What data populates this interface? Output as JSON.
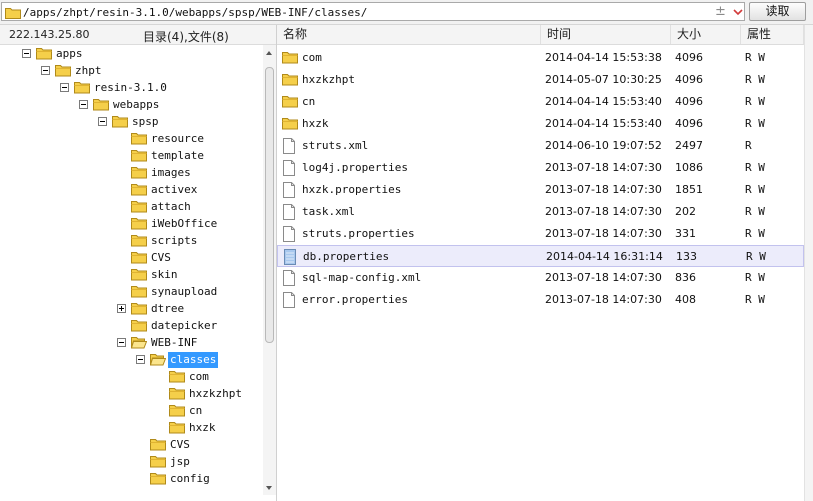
{
  "address": {
    "path": "/apps/zhpt/resin-3.1.0/webapps/spsp/WEB-INF/classes/",
    "pin_glyph": "±",
    "read_label": "读取"
  },
  "left": {
    "ip": "222.143.25.80",
    "summary": "目录(4),文件(8)",
    "tree": [
      {
        "label": "apps",
        "level": 0,
        "toggle": "minus"
      },
      {
        "label": "zhpt",
        "level": 1,
        "toggle": "minus"
      },
      {
        "label": "resin-3.1.0",
        "level": 2,
        "toggle": "minus"
      },
      {
        "label": "webapps",
        "level": 3,
        "toggle": "minus"
      },
      {
        "label": "spsp",
        "level": 4,
        "toggle": "minus"
      },
      {
        "label": "resource",
        "level": 5,
        "toggle": "none"
      },
      {
        "label": "template",
        "level": 5,
        "toggle": "none"
      },
      {
        "label": "images",
        "level": 5,
        "toggle": "none"
      },
      {
        "label": "activex",
        "level": 5,
        "toggle": "none"
      },
      {
        "label": "attach",
        "level": 5,
        "toggle": "none"
      },
      {
        "label": "iWebOffice",
        "level": 5,
        "toggle": "none"
      },
      {
        "label": "scripts",
        "level": 5,
        "toggle": "none"
      },
      {
        "label": "CVS",
        "level": 5,
        "toggle": "none"
      },
      {
        "label": "skin",
        "level": 5,
        "toggle": "none"
      },
      {
        "label": "synaupload",
        "level": 5,
        "toggle": "none"
      },
      {
        "label": "dtree",
        "level": 5,
        "toggle": "plus"
      },
      {
        "label": "datepicker",
        "level": 5,
        "toggle": "none"
      },
      {
        "label": "WEB-INF",
        "level": 5,
        "toggle": "minus",
        "open": true
      },
      {
        "label": "classes",
        "level": 6,
        "toggle": "minus",
        "open": true,
        "selected": true
      },
      {
        "label": "com",
        "level": 7,
        "toggle": "none"
      },
      {
        "label": "hxzkzhpt",
        "level": 7,
        "toggle": "none"
      },
      {
        "label": "cn",
        "level": 7,
        "toggle": "none"
      },
      {
        "label": "hxzk",
        "level": 7,
        "toggle": "none"
      },
      {
        "label": "CVS",
        "level": 6,
        "toggle": "none"
      },
      {
        "label": "jsp",
        "level": 6,
        "toggle": "none"
      },
      {
        "label": "config",
        "level": 6,
        "toggle": "none"
      }
    ]
  },
  "right": {
    "columns": [
      "名称",
      "时间",
      "大小",
      "属性"
    ],
    "rows": [
      {
        "name": "com",
        "time": "2014-04-14 15:53:38",
        "size": "4096",
        "attr": "R W",
        "type": "folder"
      },
      {
        "name": "hxzkzhpt",
        "time": "2014-05-07 10:30:25",
        "size": "4096",
        "attr": "R W",
        "type": "folder"
      },
      {
        "name": "cn",
        "time": "2014-04-14 15:53:40",
        "size": "4096",
        "attr": "R W",
        "type": "folder"
      },
      {
        "name": "hxzk",
        "time": "2014-04-14 15:53:40",
        "size": "4096",
        "attr": "R W",
        "type": "folder"
      },
      {
        "name": "struts.xml",
        "time": "2014-06-10 19:07:52",
        "size": "2497",
        "attr": "R",
        "type": "file"
      },
      {
        "name": "log4j.properties",
        "time": "2013-07-18 14:07:30",
        "size": "1086",
        "attr": "R W",
        "type": "file"
      },
      {
        "name": "hxzk.properties",
        "time": "2013-07-18 14:07:30",
        "size": "1851",
        "attr": "R W",
        "type": "file"
      },
      {
        "name": "task.xml",
        "time": "2013-07-18 14:07:30",
        "size": "202",
        "attr": "R W",
        "type": "file"
      },
      {
        "name": "struts.properties",
        "time": "2013-07-18 14:07:30",
        "size": "331",
        "attr": "R W",
        "type": "file"
      },
      {
        "name": "db.properties",
        "time": "2014-04-14 16:31:14",
        "size": "133",
        "attr": "R W",
        "type": "file",
        "selected": true
      },
      {
        "name": "sql-map-config.xml",
        "time": "2013-07-18 14:07:30",
        "size": "836",
        "attr": "R W",
        "type": "file"
      },
      {
        "name": "error.properties",
        "time": "2013-07-18 14:07:30",
        "size": "408",
        "attr": "R W",
        "type": "file"
      }
    ]
  },
  "colors": {
    "selection": "#3399ff",
    "row_selected": "#ececfb",
    "folder": "#f5cf4a"
  },
  "icons": {
    "folder": "folder-icon",
    "file": "file-icon"
  }
}
